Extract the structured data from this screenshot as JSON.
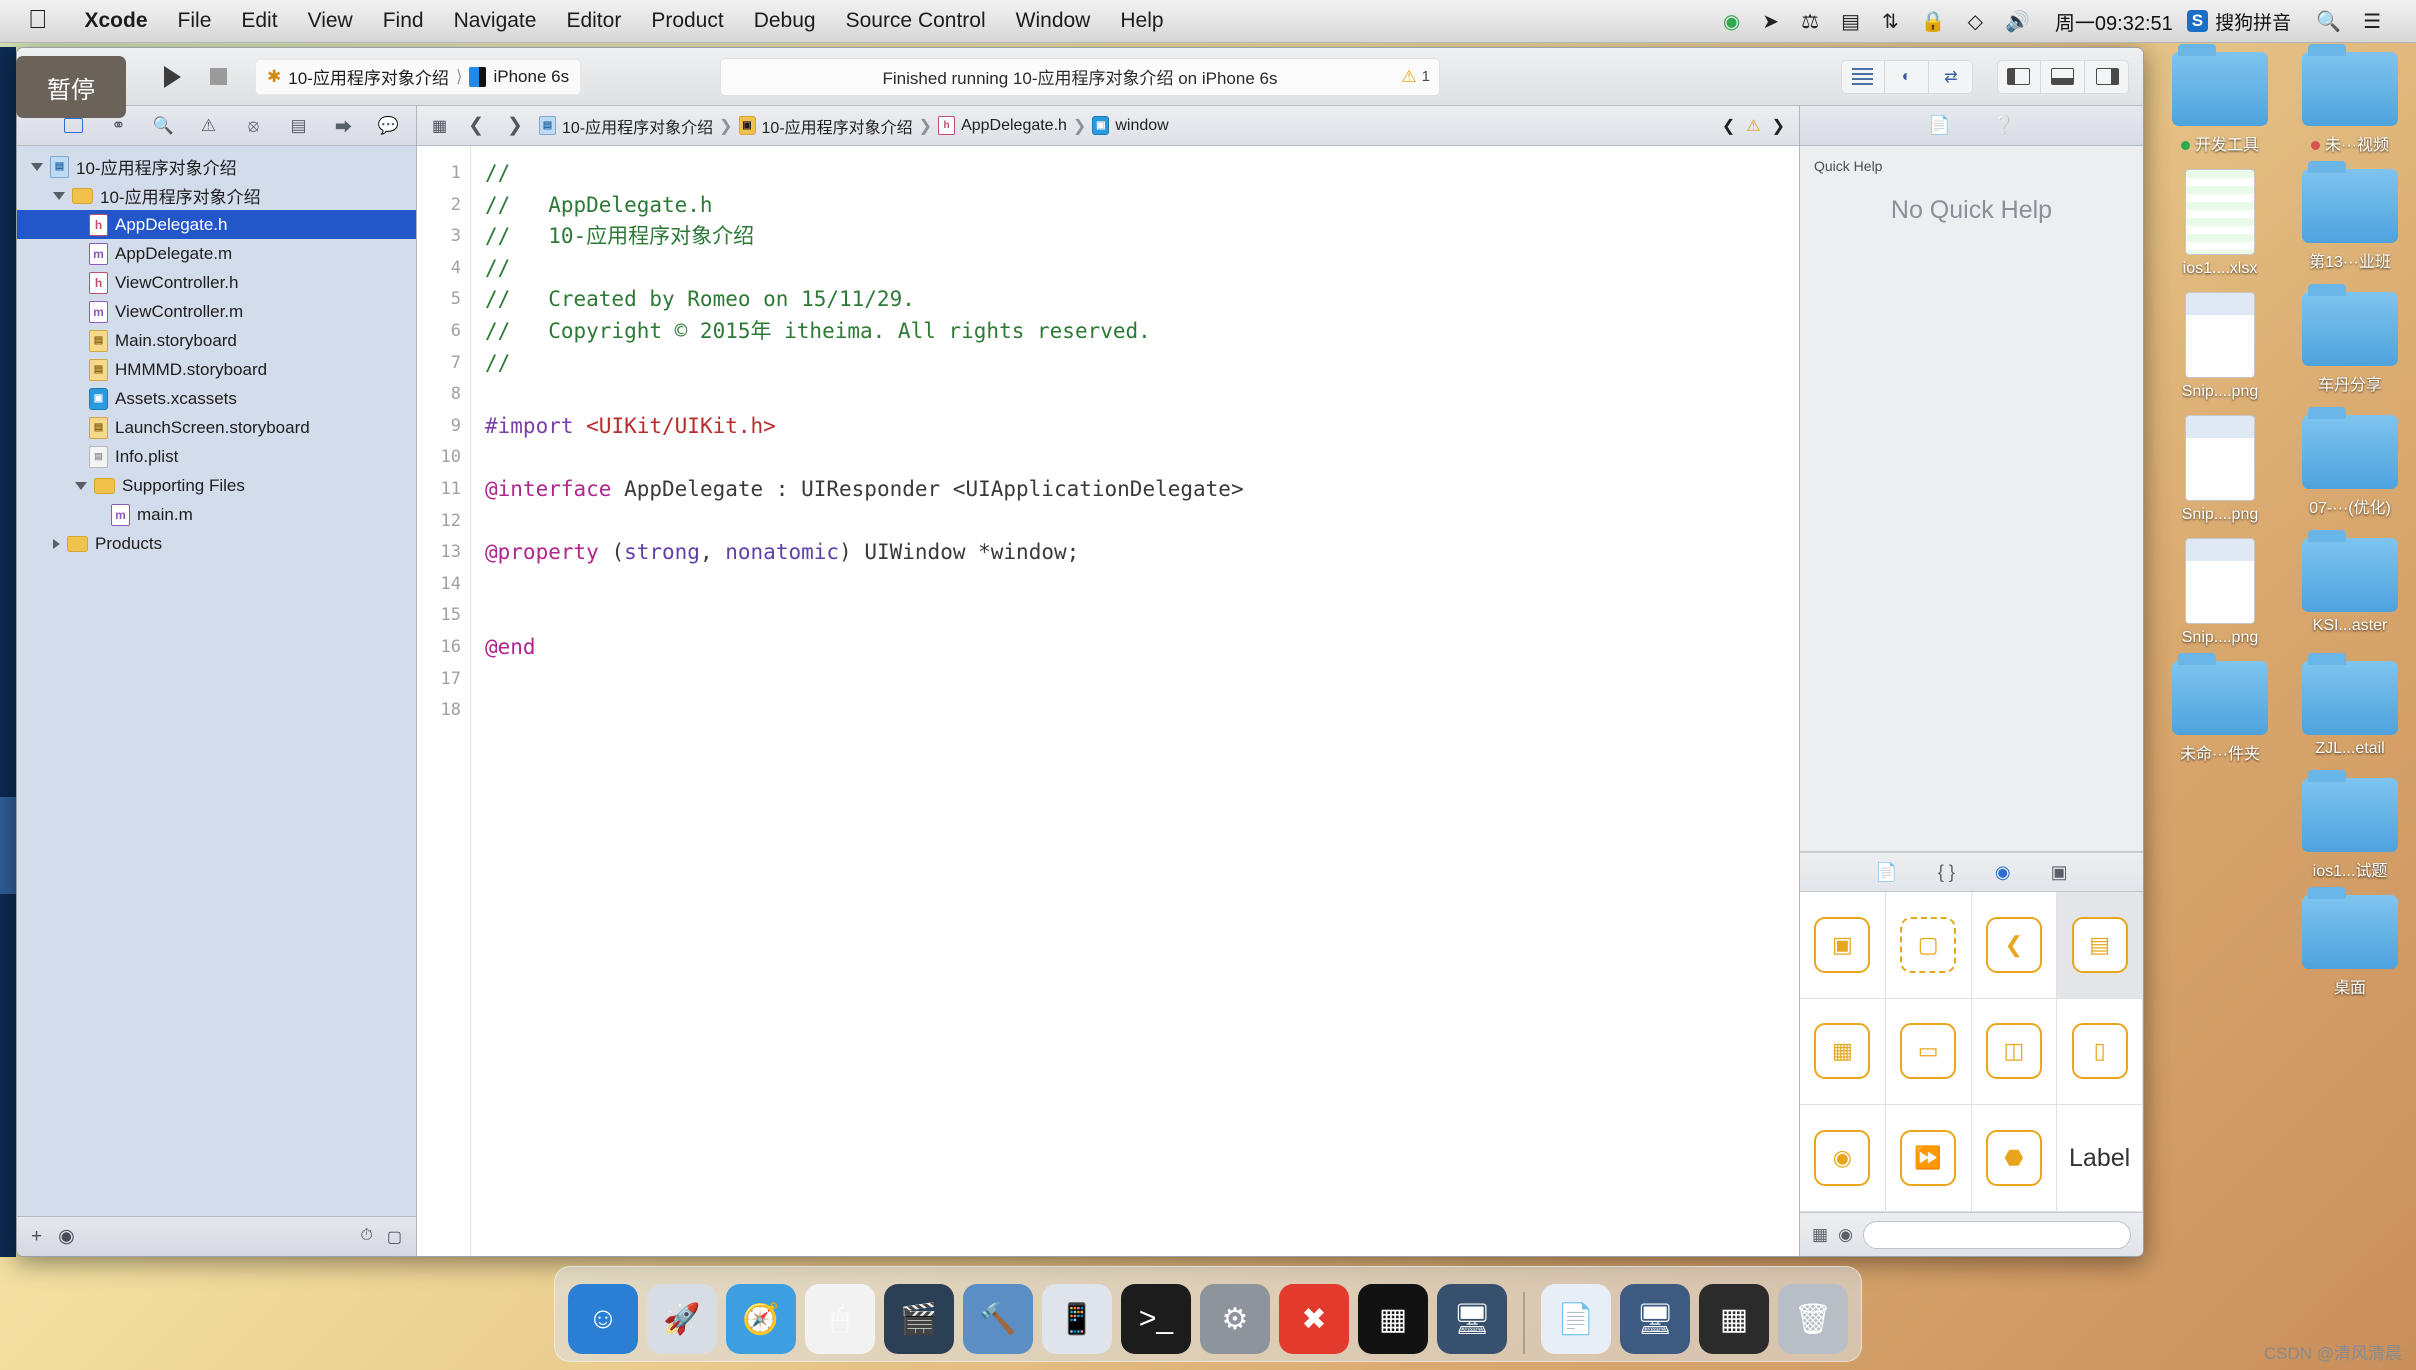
{
  "menubar": {
    "apple": "apple-logo",
    "items": [
      {
        "label": "Xcode",
        "bold": true
      },
      {
        "label": "File",
        "bold": false
      },
      {
        "label": "Edit",
        "bold": false
      },
      {
        "label": "View",
        "bold": false
      },
      {
        "label": "Find",
        "bold": false
      },
      {
        "label": "Navigate",
        "bold": false
      },
      {
        "label": "Editor",
        "bold": false
      },
      {
        "label": "Product",
        "bold": false
      },
      {
        "label": "Debug",
        "bold": false
      },
      {
        "label": "Source Control",
        "bold": false
      },
      {
        "label": "Window",
        "bold": false
      },
      {
        "label": "Help",
        "bold": false
      }
    ],
    "status_icons": [
      "download-icon",
      "location-icon",
      "bluetooth-icon",
      "screen-record-icon",
      "network-icon",
      "lock-icon",
      "wifi-icon",
      "volume-icon"
    ],
    "clock": "周一09:32:51",
    "ime_badge": "S",
    "ime_name": "搜狗拼音",
    "search_icon": "search-icon",
    "notification_icon": "notification-center-icon"
  },
  "pause_tooltip": "暂停",
  "toolbar": {
    "run_label": "run-button",
    "stop_label": "stop-button",
    "scheme": "10-应用程序对象介绍",
    "destination": "iPhone 6s",
    "status_message": "Finished running 10-应用程序对象介绍 on iPhone 6s",
    "warning_count": "1",
    "editor_segments": [
      "standard-editor",
      "assistant-editor",
      "version-editor"
    ],
    "view_segments": [
      "navigator-toggle",
      "debug-toggle",
      "utilities-toggle"
    ]
  },
  "navigator": {
    "tabs": [
      "project-navigator",
      "symbol-navigator",
      "find-navigator",
      "issue-navigator",
      "test-navigator",
      "debug-navigator",
      "breakpoint-navigator",
      "report-navigator"
    ],
    "tree": [
      {
        "label": "10-应用程序对象介绍",
        "depth": 0,
        "icon": "project",
        "twisty": "open",
        "selected": false
      },
      {
        "label": "10-应用程序对象介绍",
        "depth": 1,
        "icon": "folder",
        "twisty": "open",
        "selected": false
      },
      {
        "label": "AppDelegate.h",
        "depth": 2,
        "icon": "h",
        "twisty": "none",
        "selected": true
      },
      {
        "label": "AppDelegate.m",
        "depth": 2,
        "icon": "m",
        "twisty": "none",
        "selected": false
      },
      {
        "label": "ViewController.h",
        "depth": 2,
        "icon": "h",
        "twisty": "none",
        "selected": false
      },
      {
        "label": "ViewController.m",
        "depth": 2,
        "icon": "m",
        "twisty": "none",
        "selected": false
      },
      {
        "label": "Main.storyboard",
        "depth": 2,
        "icon": "sb",
        "twisty": "none",
        "selected": false
      },
      {
        "label": "HMMMD.storyboard",
        "depth": 2,
        "icon": "sb",
        "twisty": "none",
        "selected": false
      },
      {
        "label": "Assets.xcassets",
        "depth": 2,
        "icon": "xc",
        "twisty": "none",
        "selected": false
      },
      {
        "label": "LaunchScreen.storyboard",
        "depth": 2,
        "icon": "sb",
        "twisty": "none",
        "selected": false
      },
      {
        "label": "Info.plist",
        "depth": 2,
        "icon": "plist",
        "twisty": "none",
        "selected": false
      },
      {
        "label": "Supporting Files",
        "depth": 2,
        "icon": "folder",
        "twisty": "open",
        "selected": false
      },
      {
        "label": "main.m",
        "depth": 3,
        "icon": "m",
        "twisty": "none",
        "selected": false
      },
      {
        "label": "Products",
        "depth": 1,
        "icon": "folder",
        "twisty": "closed",
        "selected": false
      }
    ],
    "footer": {
      "add_icon": "add-button",
      "filter_icon": "filter-button",
      "recent_icon": "show-recent-files-icon",
      "source_icon": "show-source-control-icon"
    }
  },
  "jumpbar": {
    "related_icon": "related-items-icon",
    "back_icon": "back-arrow",
    "forward_icon": "forward-arrow",
    "crumbs": [
      {
        "label": "10-应用程序对象介绍",
        "icon": "project"
      },
      {
        "label": "10-应用程序对象介绍",
        "icon": "folder"
      },
      {
        "label": "AppDelegate.h",
        "icon": "h"
      },
      {
        "label": "window",
        "icon": "property"
      }
    ],
    "right_icons": [
      "prev-issue",
      "warning-icon",
      "next-issue"
    ]
  },
  "code": {
    "lines": [
      {
        "n": "1",
        "segs": [
          {
            "t": "//",
            "c": "cmt"
          }
        ]
      },
      {
        "n": "2",
        "segs": [
          {
            "t": "//   AppDelegate.h",
            "c": "cmt"
          }
        ]
      },
      {
        "n": "3",
        "segs": [
          {
            "t": "//   10-应用程序对象介绍",
            "c": "cmt"
          }
        ]
      },
      {
        "n": "4",
        "segs": [
          {
            "t": "//",
            "c": "cmt"
          }
        ]
      },
      {
        "n": "5",
        "segs": [
          {
            "t": "//   Created by Romeo on 15/11/29.",
            "c": "cmt"
          }
        ]
      },
      {
        "n": "6",
        "segs": [
          {
            "t": "//   Copyright © 2015年 itheima. All rights reserved.",
            "c": "cmt"
          }
        ]
      },
      {
        "n": "7",
        "segs": [
          {
            "t": "//",
            "c": "cmt"
          }
        ]
      },
      {
        "n": "8",
        "segs": []
      },
      {
        "n": "9",
        "segs": [
          {
            "t": "#import ",
            "c": "pre"
          },
          {
            "t": "<UIKit/UIKit.h>",
            "c": "str"
          }
        ]
      },
      {
        "n": "10",
        "segs": []
      },
      {
        "n": "11",
        "segs": [
          {
            "t": "@interface",
            "c": "kw"
          },
          {
            "t": " AppDelegate : UIResponder <UIApplicationDelegate>",
            "c": "typ"
          }
        ]
      },
      {
        "n": "12",
        "segs": []
      },
      {
        "n": "13",
        "segs": [
          {
            "t": "@property",
            "c": "kw"
          },
          {
            "t": " (",
            "c": "typ"
          },
          {
            "t": "strong",
            "c": "prm"
          },
          {
            "t": ", ",
            "c": "typ"
          },
          {
            "t": "nonatomic",
            "c": "prm"
          },
          {
            "t": ") UIWindow *window;",
            "c": "typ"
          }
        ]
      },
      {
        "n": "14",
        "segs": []
      },
      {
        "n": "15",
        "segs": []
      },
      {
        "n": "16",
        "segs": [
          {
            "t": "@end",
            "c": "kw"
          }
        ]
      },
      {
        "n": "17",
        "segs": []
      },
      {
        "n": "18",
        "segs": []
      }
    ]
  },
  "utilities": {
    "tabs": [
      "file-inspector",
      "quick-help-inspector"
    ],
    "quick_help_title": "Quick Help",
    "quick_help_empty": "No Quick Help",
    "library_tabs": [
      "file-template-library",
      "code-snippet-library",
      "object-library",
      "media-library"
    ],
    "library_items": [
      {
        "name": "view-controller-object",
        "glyph": "▣",
        "dashed": false,
        "selected": false
      },
      {
        "name": "container-view-object",
        "glyph": "▢",
        "dashed": true,
        "selected": false
      },
      {
        "name": "navigation-controller-object",
        "glyph": "❮",
        "dashed": false,
        "selected": false
      },
      {
        "name": "table-view-controller-object",
        "glyph": "▤",
        "dashed": false,
        "selected": true
      },
      {
        "name": "collection-view-controller-object",
        "glyph": "▦",
        "dashed": false,
        "selected": false
      },
      {
        "name": "tab-bar-controller-object",
        "glyph": "▭",
        "dashed": false,
        "selected": false
      },
      {
        "name": "split-view-controller-object",
        "glyph": "◫",
        "dashed": false,
        "selected": false
      },
      {
        "name": "page-view-controller-object",
        "glyph": "▯",
        "dashed": false,
        "selected": false
      },
      {
        "name": "glkit-view-controller-object",
        "glyph": "◉",
        "dashed": false,
        "selected": false
      },
      {
        "name": "avkit-player-controller-object",
        "glyph": "⏩",
        "dashed": false,
        "selected": false
      },
      {
        "name": "object-cube",
        "glyph": "⬣",
        "dashed": false,
        "selected": false
      },
      {
        "name": "label-object",
        "glyph": "Label",
        "dashed": false,
        "selected": false
      }
    ],
    "library_label_text": "Label",
    "search_placeholder": ""
  },
  "desktop": {
    "icons": [
      {
        "label": "开发工具",
        "type": "folder",
        "dot": "#2fa84f"
      },
      {
        "label": "未···视频",
        "type": "folder",
        "dot": "#d9534f"
      },
      {
        "label": "ios1....xlsx",
        "type": "xls",
        "dot": ""
      },
      {
        "label": "第13···业班",
        "type": "folder",
        "dot": ""
      },
      {
        "label": "Snip....png",
        "type": "shot",
        "dot": ""
      },
      {
        "label": "车丹分享",
        "type": "folder",
        "dot": ""
      },
      {
        "label": "Snip....png",
        "type": "shot",
        "dot": ""
      },
      {
        "label": "07-···(优化)",
        "type": "folder",
        "dot": ""
      },
      {
        "label": "Snip....png",
        "type": "shot",
        "dot": ""
      },
      {
        "label": "KSI...aster",
        "type": "folder",
        "dot": ""
      },
      {
        "label": "未命···件夹",
        "type": "folder",
        "dot": ""
      },
      {
        "label": "ZJL...etail",
        "type": "folder",
        "dot": ""
      },
      {
        "label": "",
        "type": "blank",
        "dot": ""
      },
      {
        "label": "ios1...试题",
        "type": "folder",
        "dot": ""
      },
      {
        "label": "",
        "type": "blank",
        "dot": ""
      },
      {
        "label": "桌面",
        "type": "folder",
        "dot": ""
      }
    ]
  },
  "dock": {
    "items": [
      {
        "name": "finder",
        "glyph": "☺",
        "color": "#2a7fd4"
      },
      {
        "name": "launchpad",
        "glyph": "🚀",
        "color": "#d8dde3"
      },
      {
        "name": "safari",
        "glyph": "🧭",
        "color": "#3e9fe0"
      },
      {
        "name": "mouse-app",
        "glyph": "🖱",
        "color": "#f2f2f2"
      },
      {
        "name": "video-app",
        "glyph": "🎬",
        "color": "#2b3f55"
      },
      {
        "name": "xcode",
        "glyph": "🔨",
        "color": "#5b8ec4"
      },
      {
        "name": "simulator",
        "glyph": "📱",
        "color": "#dfe4ea"
      },
      {
        "name": "terminal",
        "glyph": ">_",
        "color": "#1c1c1c"
      },
      {
        "name": "system-preferences",
        "glyph": "⚙",
        "color": "#8d949c"
      },
      {
        "name": "xmind",
        "glyph": "✖",
        "color": "#e23b2e"
      },
      {
        "name": "shadowsocks",
        "glyph": "▦",
        "color": "#121212"
      },
      {
        "name": "screens",
        "glyph": "🖥",
        "color": "#37506d"
      },
      {
        "name": "document-app",
        "glyph": "📄",
        "color": "#e8eef5"
      },
      {
        "name": "monitor-app",
        "glyph": "🖥",
        "color": "#3d5a80"
      },
      {
        "name": "calculator",
        "glyph": "▦",
        "color": "#2b2b2b"
      },
      {
        "name": "trash",
        "glyph": "🗑",
        "color": "#b8bec6"
      }
    ]
  },
  "watermark": "CSDN @清风清晨"
}
